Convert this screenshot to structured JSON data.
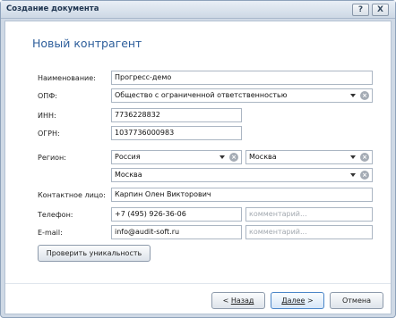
{
  "window": {
    "title": "Создание документа",
    "help_label": "?",
    "close_label": "X"
  },
  "header": {
    "title": "Новый контрагент"
  },
  "form": {
    "name": {
      "label": "Наименование:",
      "value": "Прогресс-демо"
    },
    "opf": {
      "label": "ОПФ:",
      "value": "Общество с ограниченной ответственностью"
    },
    "inn": {
      "label": "ИНН:",
      "value": "7736228832"
    },
    "ogrn": {
      "label": "ОГРН:",
      "value": "1037736000983"
    },
    "region": {
      "label": "Регион:",
      "country": "Россия",
      "region": "Москва",
      "city": "Москва"
    },
    "contact": {
      "label": "Контактное лицо:",
      "value": "Карпин Олен Викторович"
    },
    "phone": {
      "label": "Телефон:",
      "value": "+7 (495) 926-36-06",
      "comment_placeholder": "комментарий..."
    },
    "email": {
      "label": "E-mail:",
      "value": "info@audit-soft.ru",
      "comment_placeholder": "комментарий..."
    },
    "check_button": "Проверить уникальность"
  },
  "footer": {
    "back_prefix": "< ",
    "back_label": "Назад",
    "next_label": "Далее",
    "next_suffix": " >",
    "cancel_label": "Отмена"
  }
}
